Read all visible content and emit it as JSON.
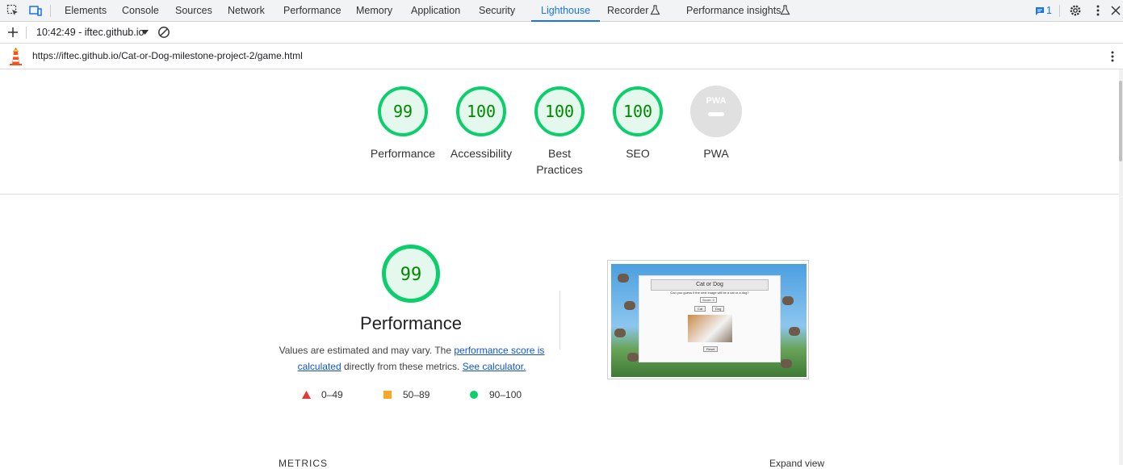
{
  "devtools": {
    "tabs": [
      {
        "label": "Elements"
      },
      {
        "label": "Console"
      },
      {
        "label": "Sources"
      },
      {
        "label": "Network"
      },
      {
        "label": "Performance"
      },
      {
        "label": "Memory"
      },
      {
        "label": "Application"
      },
      {
        "label": "Security"
      },
      {
        "label": "Lighthouse"
      },
      {
        "label": "Recorder"
      },
      {
        "label": "Performance insights"
      }
    ],
    "active_tab": "Lighthouse",
    "issues_count": "1"
  },
  "toolbar": {
    "report_label": "10:42:49 - iftec.github.io"
  },
  "url": "https://iftec.github.io/Cat-or-Dog-milestone-project-2/game.html",
  "scores": [
    {
      "label": "Performance",
      "value": "99"
    },
    {
      "label": "Accessibility",
      "value": "100"
    },
    {
      "label": "Best Practices",
      "value": "100"
    },
    {
      "label": "SEO",
      "value": "100"
    },
    {
      "label": "PWA",
      "value": ""
    }
  ],
  "pwa_badge": "PWA",
  "performance": {
    "score": "99",
    "title": "Performance",
    "desc_prefix": "Values are estimated and may vary. The ",
    "desc_link1": "performance score is calculated",
    "desc_mid": " directly from these metrics. ",
    "desc_link2": "See calculator."
  },
  "legend": [
    {
      "label": "0–49",
      "color": "#e53935"
    },
    {
      "label": "50–89",
      "color": "#f9a825"
    },
    {
      "label": "90–100",
      "color": "#0cce6b"
    }
  ],
  "thumbnail": {
    "title": "Cat or Dog",
    "subtitle": "Can you guess if the next image will be a cat or a dog?",
    "score": "Score: 0",
    "cat_button": "Cat",
    "dog_button": "Dog",
    "reset_button": "Reset"
  },
  "metrics_heading": "METRICS",
  "expand_view": "Expand view",
  "colors": {
    "pass": "#0cce6b",
    "pass_text": "#008800",
    "pass_bg": "#e5f8ed",
    "accent": "#1a73e8"
  }
}
